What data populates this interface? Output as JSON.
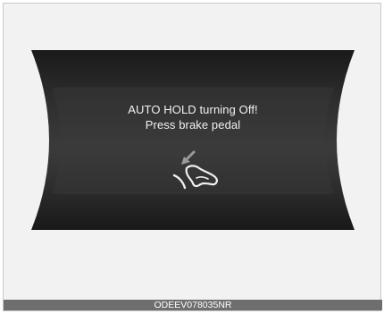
{
  "display": {
    "message_line1": "AUTO HOLD turning Off!",
    "message_line2": "Press brake pedal",
    "icon": "brake-pedal-press-icon"
  },
  "caption": {
    "code": "ODEEV078035NR"
  },
  "colors": {
    "page_background": "#f2f2f2",
    "screen_dark": "#1c1c1c",
    "screen_mid": "#3a3a3a",
    "text": "#f2f2f2",
    "caption_bar": "#6e6e6e"
  }
}
